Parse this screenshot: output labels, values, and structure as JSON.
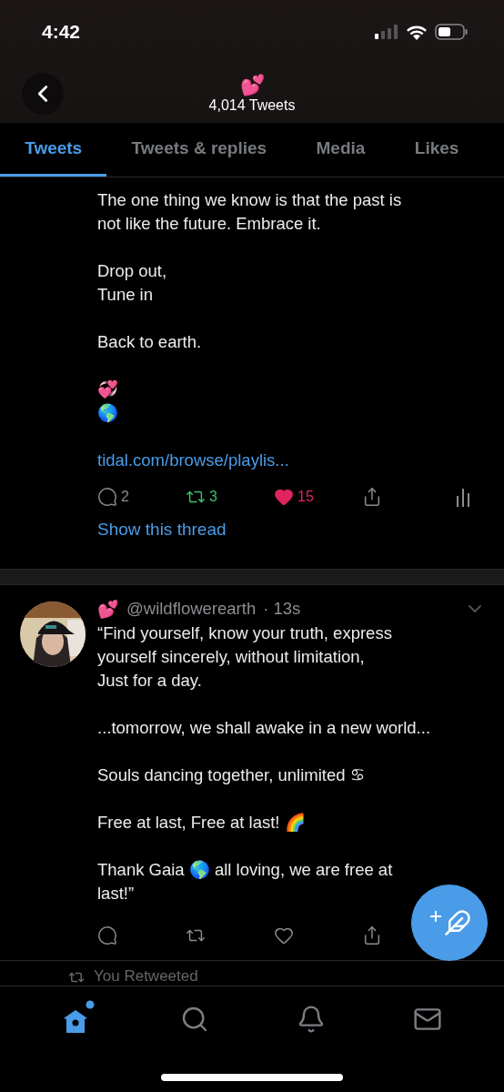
{
  "status_bar": {
    "time": "4:42"
  },
  "header": {
    "emoji": "💕",
    "subtitle": "4,014 Tweets"
  },
  "tabs": [
    {
      "label": "Tweets",
      "selected": true
    },
    {
      "label": "Tweets & replies",
      "selected": false
    },
    {
      "label": "Media",
      "selected": false
    },
    {
      "label": "Likes",
      "selected": false
    }
  ],
  "tweets": [
    {
      "paragraphs": [
        "The one thing we know is that the past is\nnot like the future. Embrace it.",
        "Drop out,\nTune in",
        "Back to earth.",
        "💞\n🌎"
      ],
      "link": "tidal.com/browse/playlis...",
      "actions": [
        {
          "kind": "reply",
          "count": "2"
        },
        {
          "kind": "retweet",
          "count": "3",
          "active": true
        },
        {
          "kind": "like",
          "count": "15",
          "active": true
        },
        {
          "kind": "share"
        },
        {
          "kind": "analytics"
        }
      ],
      "show_thread": "Show this thread"
    },
    {
      "avatar": {
        "kind": "picture"
      },
      "name": "💕",
      "handle": "@wildflowerearth",
      "time": "· 13s",
      "paragraphs": [
        "“Find yourself, know your truth, express\nyourself sincerely, without limitation,\nJust for a day.",
        "...tomorrow, we shall awake in a new world...",
        "Souls dancing together, unlimited ♋",
        "Free at last, Free at last! 🌈",
        "Thank Gaia 🌎 all loving, we are free at\nlast!”"
      ],
      "actions": [
        {
          "kind": "reply"
        },
        {
          "kind": "retweet",
          "active": false
        },
        {
          "kind": "like",
          "active": false
        },
        {
          "kind": "share"
        }
      ]
    }
  ],
  "retweet_notice": "You Retweeted",
  "nav": [
    {
      "kind": "home",
      "selected": true,
      "badge": true
    },
    {
      "kind": "search",
      "selected": false
    },
    {
      "kind": "notifications",
      "selected": false
    },
    {
      "kind": "messages",
      "selected": false
    }
  ]
}
